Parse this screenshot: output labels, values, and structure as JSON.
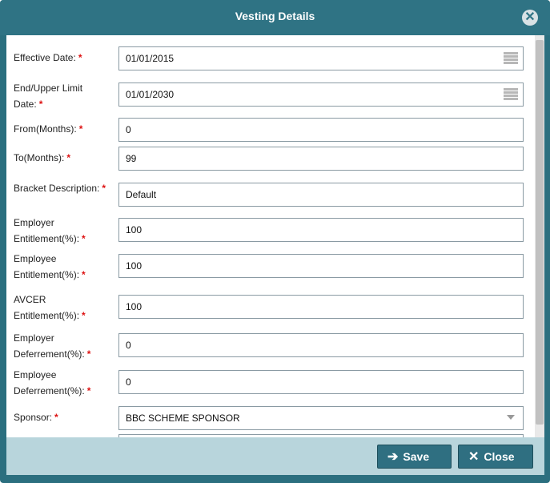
{
  "dialog": {
    "title": "Vesting Details",
    "close_icon_glyph": "✕"
  },
  "form": {
    "effective_date": {
      "label": "Effective Date:",
      "required": "*",
      "value": "01/01/2015"
    },
    "end_date": {
      "label_line1": "End/Upper Limit",
      "label_line2": "Date:",
      "required": "*",
      "value": "01/01/2030"
    },
    "from_months": {
      "label": "From(Months):",
      "required": "*",
      "value": "0"
    },
    "to_months": {
      "label": "To(Months):",
      "required": "*",
      "value": "99"
    },
    "bracket_description": {
      "label": "Bracket Description:",
      "required": "*",
      "value": "Default"
    },
    "employer_entitlement": {
      "label_line1": "Employer",
      "label_line2": "Entitlement(%):",
      "required": "*",
      "value": "100"
    },
    "employee_entitlement": {
      "label_line1": "Employee",
      "label_line2": "Entitlement(%):",
      "required": "*",
      "value": "100"
    },
    "avcer_entitlement": {
      "label_line1": "AVCER",
      "label_line2": "Entitlement(%):",
      "required": "*",
      "value": "100"
    },
    "employer_deferrement": {
      "label_line1": "Employer",
      "label_line2": "Deferrement(%):",
      "required": "*",
      "value": "0"
    },
    "employee_deferrement": {
      "label_line1": "Employee",
      "label_line2": "Deferrement(%):",
      "required": "*",
      "value": "0"
    },
    "sponsor": {
      "label": "Sponsor:",
      "required": "*",
      "value": "BBC SCHEME SPONSOR"
    }
  },
  "footer": {
    "save_label": "Save",
    "close_label": "Close"
  },
  "icons": {
    "save": "save-arrow-icon",
    "close": "close-x-icon",
    "calendar": "calendar-icon",
    "dropdown": "chevron-down-icon"
  },
  "colors": {
    "titlebar": "#2f7384",
    "footer": "#b8d5dc",
    "button": "#2f6f81",
    "required": "#dd1111"
  }
}
